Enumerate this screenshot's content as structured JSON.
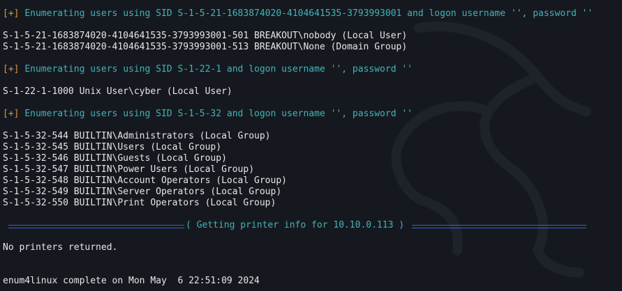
{
  "sections": [
    {
      "tag": "[+]",
      "header": "Enumerating users using SID S-1-5-21-1683874020-4104641535-3793993001 and logon username '', password ''",
      "lines": [
        "S-1-5-21-1683874020-4104641535-3793993001-501 BREAKOUT\\nobody (Local User)",
        "S-1-5-21-1683874020-4104641535-3793993001-513 BREAKOUT\\None (Domain Group)"
      ]
    },
    {
      "tag": "[+]",
      "header": "Enumerating users using SID S-1-22-1 and logon username '', password ''",
      "lines": [
        "S-1-22-1-1000 Unix User\\cyber (Local User)"
      ]
    },
    {
      "tag": "[+]",
      "header": "Enumerating users using SID S-1-5-32 and logon username '', password ''",
      "lines": [
        "S-1-5-32-544 BUILTIN\\Administrators (Local Group)",
        "S-1-5-32-545 BUILTIN\\Users (Local Group)",
        "S-1-5-32-546 BUILTIN\\Guests (Local Group)",
        "S-1-5-32-547 BUILTIN\\Power Users (Local Group)",
        "S-1-5-32-548 BUILTIN\\Account Operators (Local Group)",
        "S-1-5-32-549 BUILTIN\\Server Operators (Local Group)",
        "S-1-5-32-550 BUILTIN\\Print Operators (Local Group)"
      ]
    }
  ],
  "separator": {
    "title": "( Getting printer info for 10.10.0.113 )"
  },
  "printer_result": "No printers returned.",
  "completion": "enum4linux complete on Mon May  6 22:51:09 2024",
  "colors": {
    "background": "#15191f",
    "tag": "#d99a3c",
    "info": "#42b3b8",
    "separator": "#3a5fc8",
    "text": "#e6e6e6"
  }
}
